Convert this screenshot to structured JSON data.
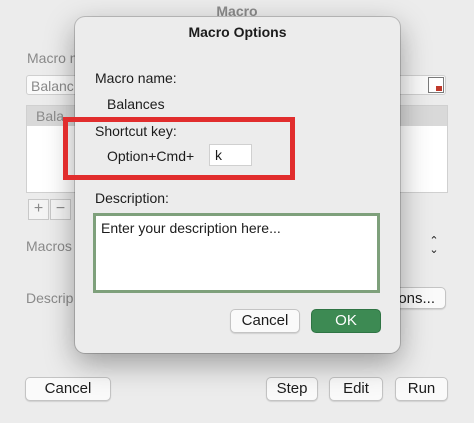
{
  "background_window": {
    "title": "Macro",
    "macro_name_label": "Macro n",
    "macro_name_value": "Balanc",
    "list_item": "Bala",
    "plus_label": "+",
    "minus_label": "−",
    "macros_in_label": "Macros",
    "description_label": "Descrip",
    "options_button": "ons...",
    "cancel_button": "Cancel",
    "step_button": "Step",
    "edit_button": "Edit",
    "run_button": "Run"
  },
  "dialog": {
    "title": "Macro Options",
    "macro_name_label": "Macro name:",
    "macro_name_value": "Balances",
    "shortcut_key_label": "Shortcut key:",
    "shortcut_prefix": "Option+Cmd+",
    "shortcut_key_value": "k",
    "description_label": "Description:",
    "description_placeholder": "Enter your description here...",
    "cancel_button": "Cancel",
    "ok_button": "OK"
  },
  "colors": {
    "highlight_box": "#e12d2d",
    "ok_button": "#3d8a53",
    "description_border": "#7ea07b"
  }
}
